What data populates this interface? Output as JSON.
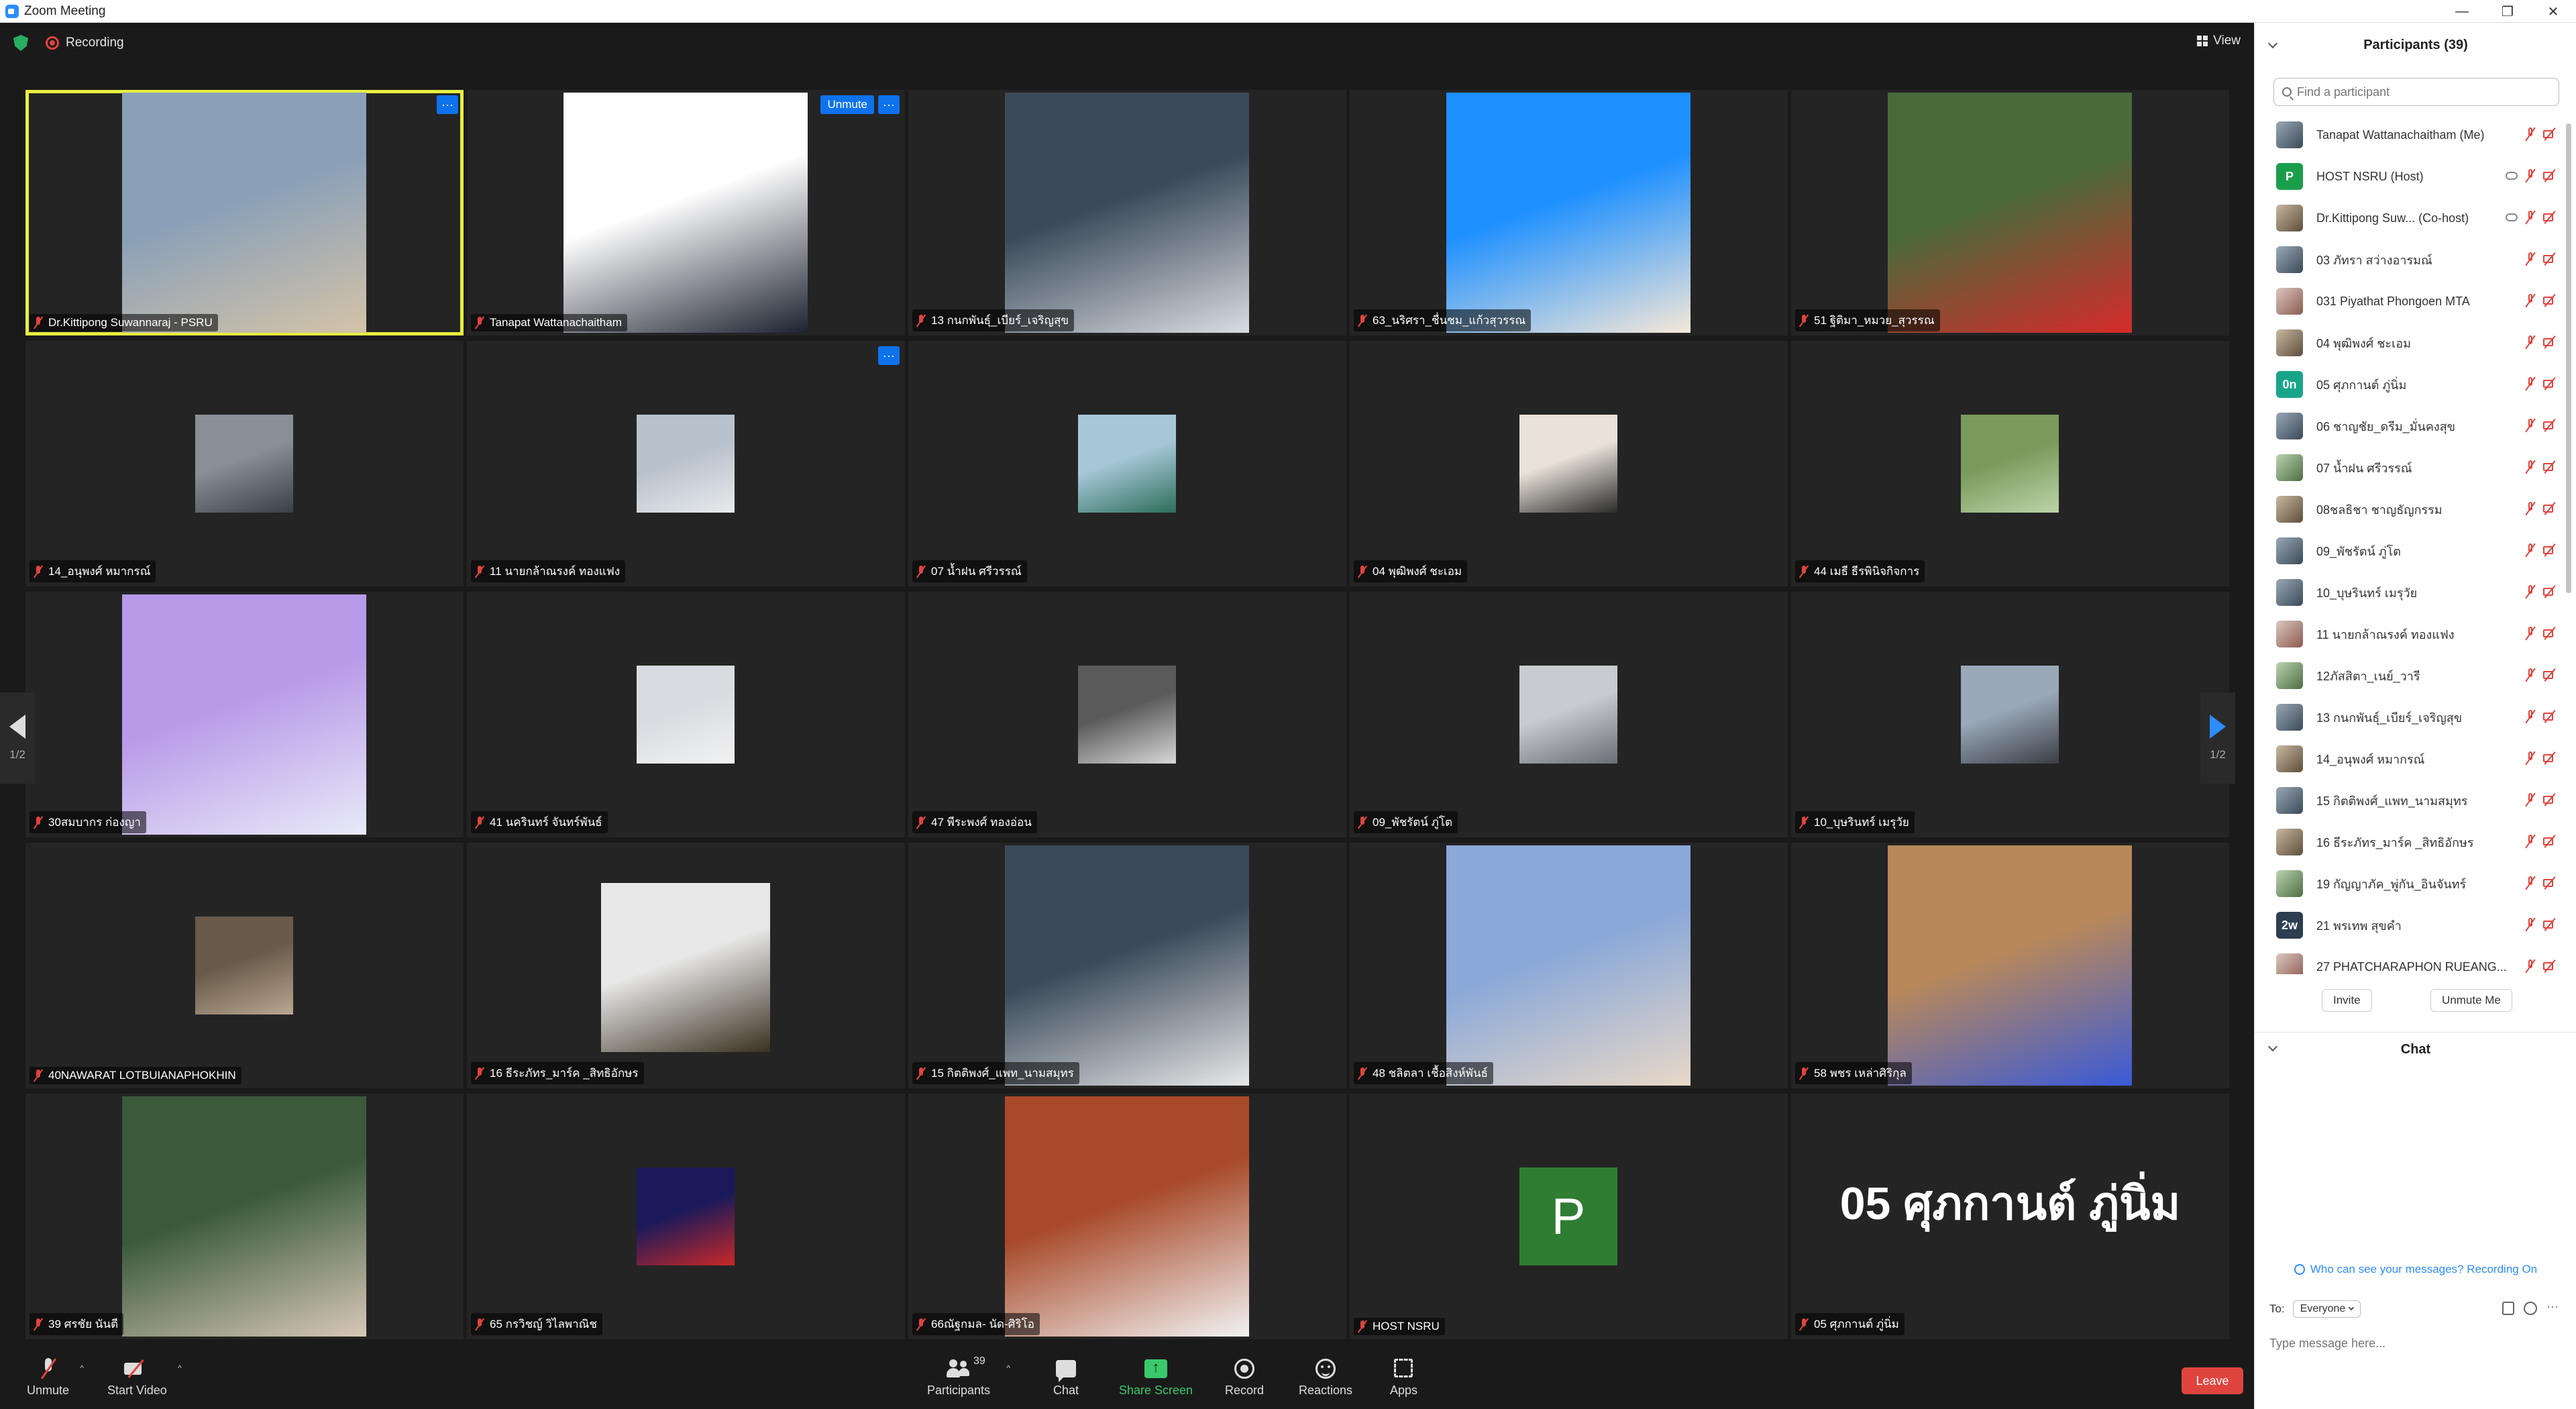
{
  "window": {
    "title": "Zoom Meeting",
    "controls": [
      "—",
      "❐",
      "✕"
    ]
  },
  "topbar": {
    "recording_label": "Recording",
    "view_label": "View"
  },
  "gallery": {
    "page_indicator": "1/2",
    "tiles": [
      {
        "name": "Dr.Kittipong Suwannaraj - PSRU",
        "photo": "large",
        "active": true,
        "more": true,
        "colors": [
          "#8aa0b8",
          "#d4c3a8"
        ]
      },
      {
        "name": "Tanapat Wattanachaitham",
        "photo": "large",
        "unmute": true,
        "more": true,
        "colors": [
          "#ffffff",
          "#1d2230"
        ]
      },
      {
        "name": "13 กนกพันธุ์_เบียร์_เจริญสุข",
        "photo": "large",
        "colors": [
          "#3b4a5a",
          "#d8dde2"
        ]
      },
      {
        "name": "63_นริศรา_ชื่นชม_แก้วสุวรรณ",
        "photo": "large",
        "colors": [
          "#1e90ff",
          "#f5e8d8"
        ]
      },
      {
        "name": "51 ฐิติมา_หมวย_สุวรรณ",
        "photo": "large",
        "colors": [
          "#4a6a3a",
          "#d62b2b"
        ]
      },
      {
        "name": "14_อนุพงศ์ หมากรณ์",
        "photo": "small",
        "colors": [
          "#8a8f96",
          "#3b3f46"
        ]
      },
      {
        "name": "11 นายกล้าณรงค์ ทองแฟง",
        "photo": "small",
        "more": true,
        "colors": [
          "#b8c2cc",
          "#e8eaec"
        ]
      },
      {
        "name": "07 น้ำฝน ศรีวรรณ์",
        "photo": "small",
        "colors": [
          "#a6c7d8",
          "#2d6e5a"
        ]
      },
      {
        "name": "04 พุฒิพงศ์ ชะเอม",
        "photo": "small",
        "colors": [
          "#e8e2d8",
          "#2a2a2a"
        ]
      },
      {
        "name": "44 เมธี ธีรพินิจกิจการ",
        "photo": "small",
        "colors": [
          "#7a9a5c",
          "#bcd4a8"
        ]
      },
      {
        "name": "30สมบากร ก่องญา",
        "photo": "large",
        "colors": [
          "#b89ae8",
          "#e8eaf8"
        ]
      },
      {
        "name": "41 นครินทร์ จันทร์พันธ์",
        "photo": "small",
        "colors": [
          "#d8dce0",
          "#f2f2f2"
        ]
      },
      {
        "name": "47 พีระพงศ์ ทองอ่อน",
        "photo": "small",
        "colors": [
          "#5a5a5a",
          "#d8d8d8"
        ]
      },
      {
        "name": "09_พัชรัตน์ ภู่โต",
        "photo": "small",
        "colors": [
          "#c8ccd0",
          "#6a6e74"
        ]
      },
      {
        "name": "10_บุษรินทร์ เมรุวัย",
        "photo": "small",
        "colors": [
          "#9aa8b8",
          "#3a3e46"
        ]
      },
      {
        "name": "40NAWARAT LOTBUIANAPHOKHIN",
        "photo": "small",
        "colors": [
          "#6a5a4a",
          "#b8a890"
        ]
      },
      {
        "name": "16 ธีระภัทร_มาร์ค _สิทธิอักษร",
        "photo": "med",
        "colors": [
          "#e8e8e8",
          "#3a3020"
        ]
      },
      {
        "name": "15 กิตติพงศ์_แพท_นามสมุทร",
        "photo": "large",
        "colors": [
          "#3a4a5a",
          "#e8e8e8"
        ]
      },
      {
        "name": "48 ชลิตลา เชื้อสิงห์พันธ์",
        "photo": "large",
        "colors": [
          "#8aa8d8",
          "#e8d8c8"
        ]
      },
      {
        "name": "58 พชร เหล่าศิริกุล",
        "photo": "large",
        "colors": [
          "#b8885a",
          "#3a5ad8"
        ]
      },
      {
        "name": "39 ศรชัย นันตี",
        "photo": "large",
        "colors": [
          "#3a5a3a",
          "#d8c8b8"
        ]
      },
      {
        "name": "65 กรวิชญ์ วิไลพาณิช",
        "photo": "small",
        "colors": [
          "#1a1a5a",
          "#c82828"
        ]
      },
      {
        "name": "66ณัฐกมล- นัด-ศิริโอ",
        "photo": "large",
        "colors": [
          "#a84a2a",
          "#f2f2f2"
        ]
      },
      {
        "name": "HOST NSRU",
        "avatar_letter": "P",
        "colors": [
          "#2e7d32",
          "#2e7d32"
        ]
      },
      {
        "name": "05 ศุภกานต์ ภู่นิ่ม",
        "name_only": "05 ศุภกานต์ ภู่นิ่ม",
        "colors": [
          "#242424",
          "#242424"
        ]
      }
    ]
  },
  "toolbar": {
    "unmute": "Unmute",
    "start_video": "Start Video",
    "participants": "Participants",
    "participants_count": "39",
    "chat": "Chat",
    "share_screen": "Share Screen",
    "record": "Record",
    "reactions": "Reactions",
    "apps": "Apps",
    "leave": "Leave"
  },
  "tile_buttons": {
    "unmute": "Unmute",
    "more": "···"
  },
  "participants_panel": {
    "title": "Participants (39)",
    "search_placeholder": "Find a participant",
    "items": [
      {
        "name": "Tanapat Wattanachaitham (Me)",
        "avatar": "",
        "style": "photo2"
      },
      {
        "name": "HOST NSRU (Host)",
        "avatar": "P",
        "style": "green",
        "cloud": true
      },
      {
        "name": "Dr.Kittipong Suw... (Co-host)",
        "avatar": "",
        "style": "photo1",
        "cloud": true
      },
      {
        "name": "03 ภัทรา สว่างอารมณ์",
        "avatar": "",
        "style": "photo2"
      },
      {
        "name": "031 Piyathat Phongoen MTA",
        "avatar": "",
        "style": "photo4"
      },
      {
        "name": "04 พุฒิพงศ์ ชะเอม",
        "avatar": "",
        "style": "photo1"
      },
      {
        "name": "05 ศุภกานต์ ภู่นิ่ม",
        "avatar": "0n",
        "style": "teal"
      },
      {
        "name": "06 ชาญชัย_ดรีม_มั่นคงสุข",
        "avatar": "",
        "style": "photo2"
      },
      {
        "name": "07 น้ำฝน ศรีวรรณ์",
        "avatar": "",
        "style": "photo3"
      },
      {
        "name": "08ชลธิชา ชาญธัญกรรม",
        "avatar": "",
        "style": "photo1"
      },
      {
        "name": "09_พัชรัตน์ ภู่โต",
        "avatar": "",
        "style": "photo2"
      },
      {
        "name": "10_บุษรินทร์ เมรุวัย",
        "avatar": "",
        "style": "photo2"
      },
      {
        "name": "11 นายกล้าณรงค์ ทองแฟง",
        "avatar": "",
        "style": "photo4"
      },
      {
        "name": "12ภัสสิตา_เนย์_วารี",
        "avatar": "",
        "style": "photo3"
      },
      {
        "name": "13 กนกพันธุ์_เบียร์_เจริญสุข",
        "avatar": "",
        "style": "photo2"
      },
      {
        "name": "14_อนุพงศ์ หมากรณ์",
        "avatar": "",
        "style": "photo1"
      },
      {
        "name": "15 กิตติพงศ์_แพท_นามสมุทร",
        "avatar": "",
        "style": "photo2"
      },
      {
        "name": "16 ธีระภัทร_มาร์ค _สิทธิอักษร",
        "avatar": "",
        "style": "photo1"
      },
      {
        "name": "19 กัญญาภัค_พู่กัน_อินจันทร์",
        "avatar": "",
        "style": "photo3"
      },
      {
        "name": "21 พรเทพ สุขคำ",
        "avatar": "2w",
        "style": "navy"
      },
      {
        "name": "27 PHATCHARAPHON RUEANG...",
        "avatar": "",
        "style": "photo4"
      }
    ],
    "invite": "Invite",
    "unmute_me": "Unmute Me"
  },
  "chat_panel": {
    "title": "Chat",
    "notice": "Who can see your messages? Recording On",
    "to_label": "To:",
    "to_value": "Everyone",
    "input_placeholder": "Type message here..."
  }
}
